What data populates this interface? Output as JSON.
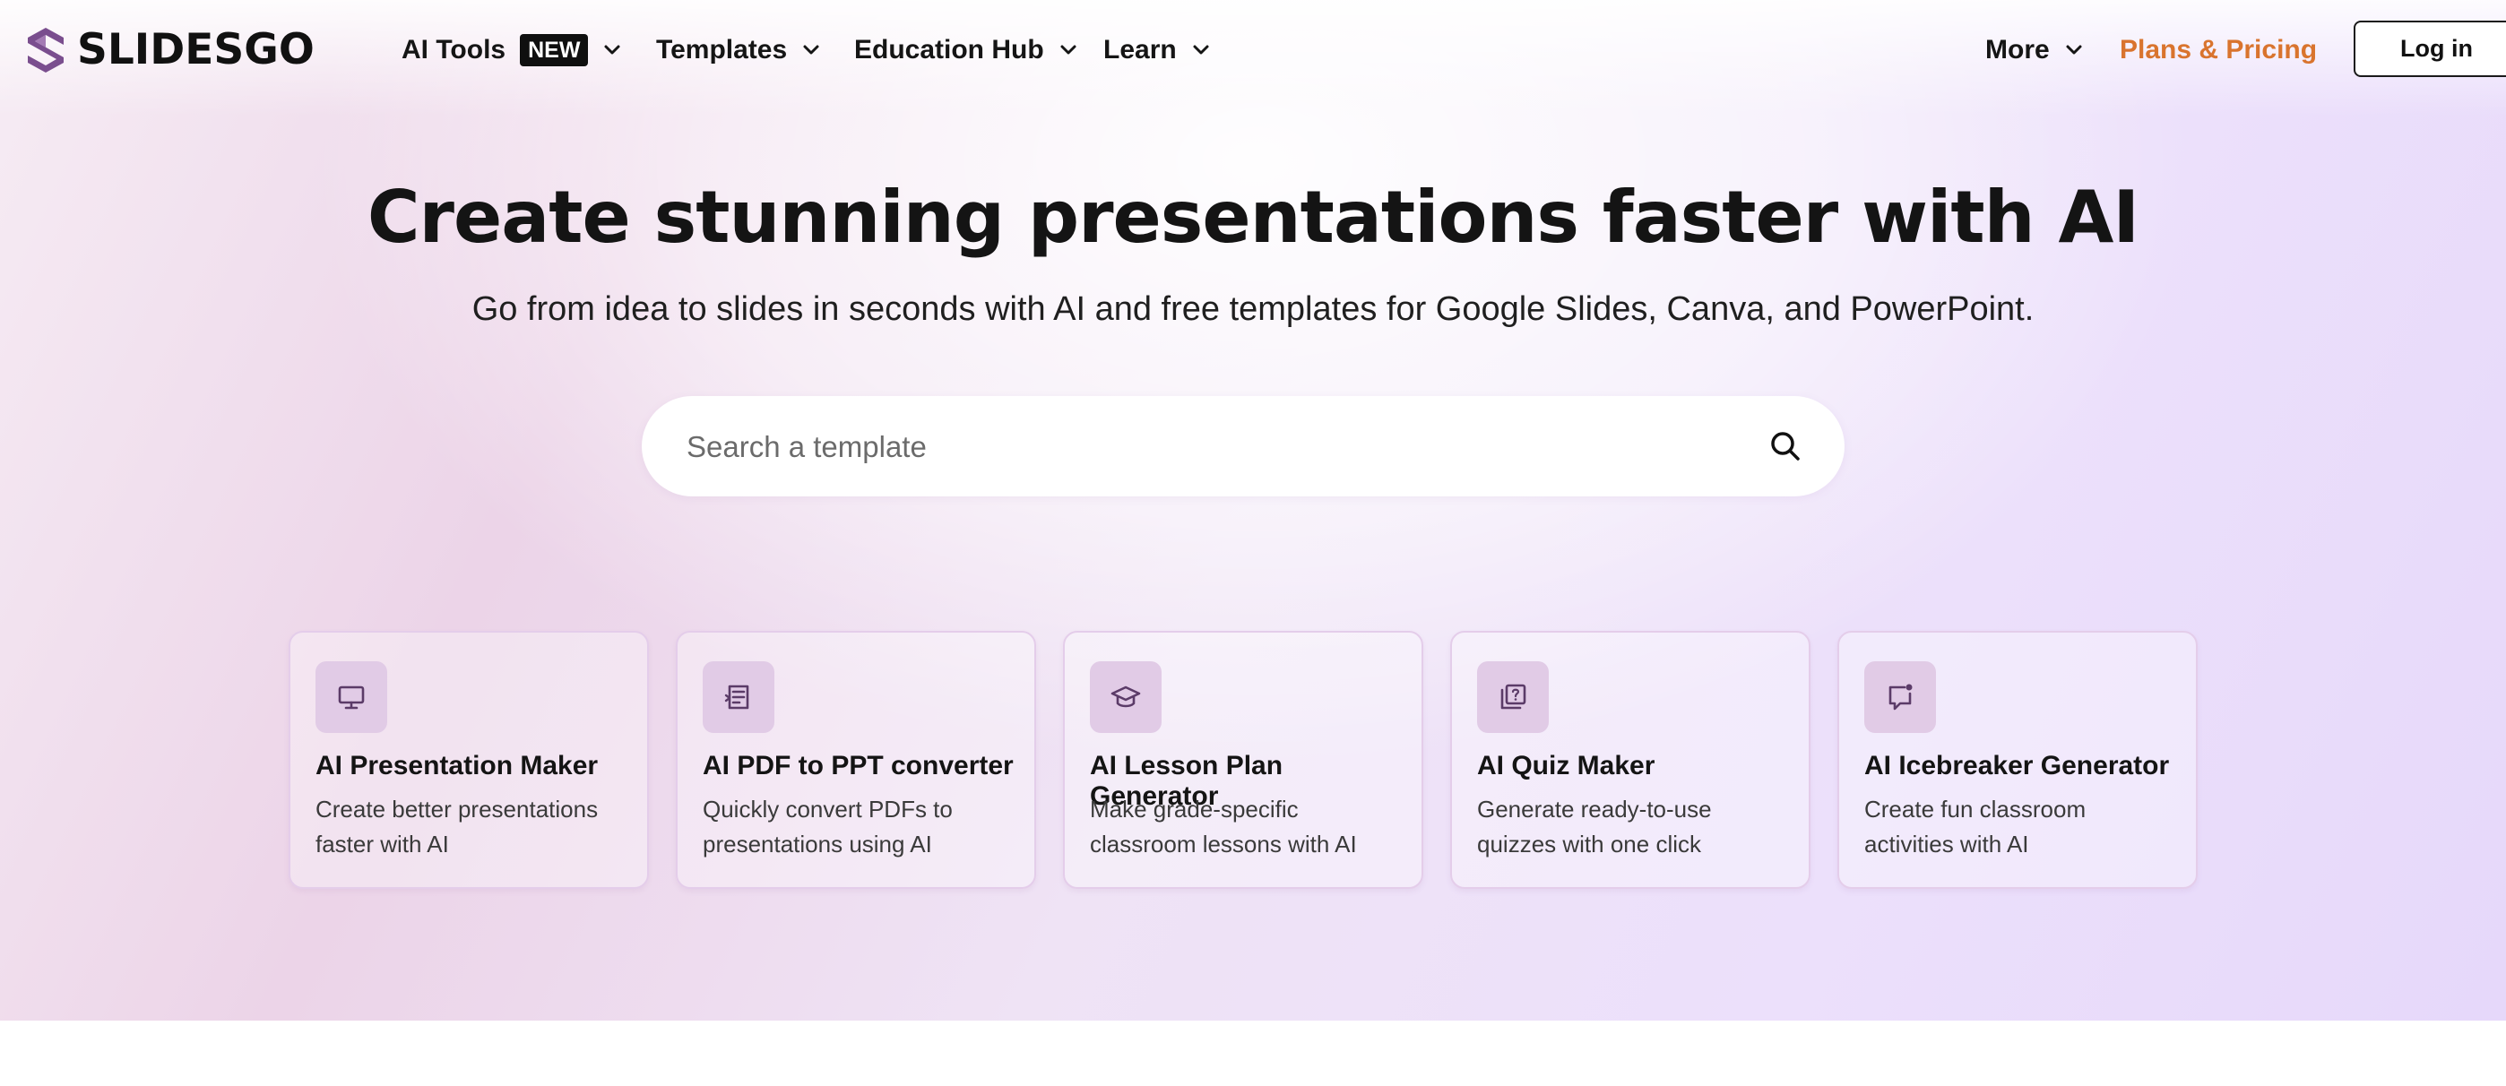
{
  "brand": {
    "name": "SLIDESGO",
    "logo_icon": "slidesgo-s-logo",
    "logo_color": "#7a4e8e"
  },
  "nav": {
    "items": [
      {
        "label": "AI Tools",
        "badge": "NEW"
      },
      {
        "label": "Templates"
      },
      {
        "label": "Education Hub"
      },
      {
        "label": "Learn"
      }
    ],
    "more_label": "More",
    "pricing_label": "Plans & Pricing",
    "pricing_color": "#d9742e",
    "login_label": "Log in"
  },
  "hero": {
    "headline": "Create stunning presentations faster with AI",
    "subheadline": "Go from idea to slides in seconds with AI and free templates for Google Slides, Canva, and PowerPoint.",
    "search_placeholder": "Search a template"
  },
  "tools": [
    {
      "icon": "monitor-icon",
      "title": "AI Presentation Maker",
      "description": "Create better presentations faster with AI"
    },
    {
      "icon": "pdf-convert-icon",
      "title": "AI PDF to PPT converter",
      "description": "Quickly convert PDFs to presentations using AI"
    },
    {
      "icon": "graduation-cap-icon",
      "title": "AI Lesson Plan Generator",
      "description": "Make grade-specific classroom lessons with AI"
    },
    {
      "icon": "quiz-icon",
      "title": "AI Quiz Maker",
      "description": "Generate ready-to-use quizzes with one click"
    },
    {
      "icon": "chat-bubble-icon",
      "title": "AI Icebreaker Generator",
      "description": "Create fun classroom activities with AI"
    }
  ],
  "colors": {
    "accent_icon_bg": "#e1cbe6",
    "icon_stroke": "#5b3b68"
  }
}
